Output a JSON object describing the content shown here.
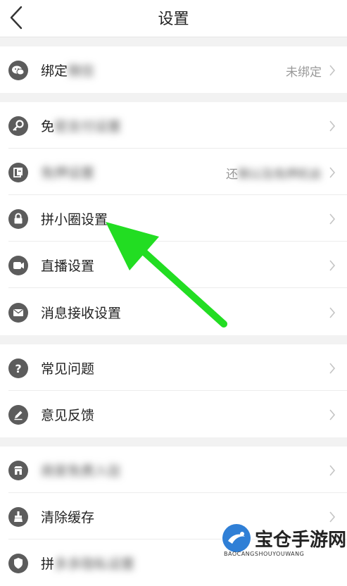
{
  "header": {
    "title": "设置"
  },
  "rows": [
    {
      "label": "绑定",
      "label_blur": "微信",
      "value": "未绑定"
    },
    {
      "label": "免",
      "label_blur": "密支付设置"
    },
    {
      "label_blur": "免押设置",
      "value": "还",
      "value_blur": "剩以及免押机会"
    },
    {
      "label": "拼小圈设置"
    },
    {
      "label": "直播设置"
    },
    {
      "label": "消息接收设置"
    },
    {
      "label": "常见问题"
    },
    {
      "label": "意见反馈"
    },
    {
      "label_blur": "商家免费入驻"
    },
    {
      "label": "清除缓存"
    },
    {
      "label": "拼",
      "label_blur": "多多隐私设置"
    }
  ],
  "icons": [
    "wechat-icon",
    "key-icon",
    "deposit-card-icon",
    "lock-icon",
    "video-camera-icon",
    "mail-icon",
    "question-icon",
    "pencil-icon",
    "store-icon",
    "broom-icon",
    "shield-icon"
  ],
  "watermark": {
    "title": "宝仓手游网",
    "subtitle": "BAOCANGSHOUYOUWANG"
  },
  "colors": {
    "icon_bg": "#5c5c5c",
    "divider_gap": "#f2f2f2",
    "arrow": "#22dd22"
  }
}
